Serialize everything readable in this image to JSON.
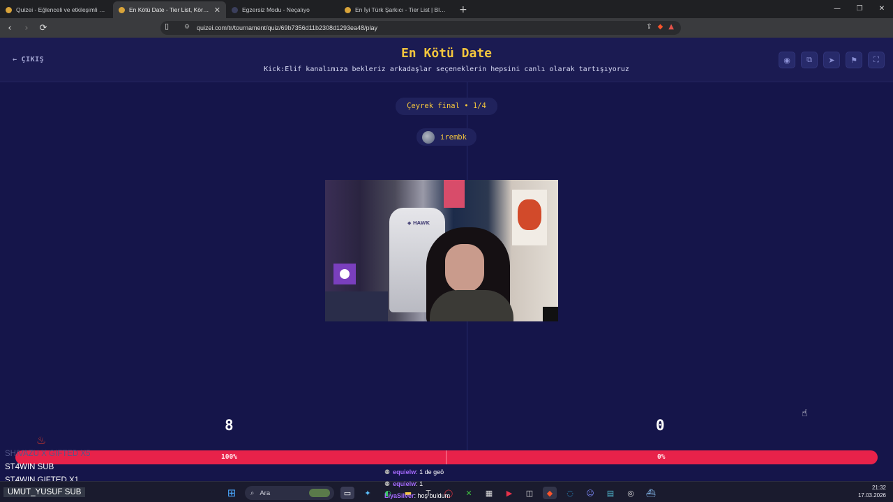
{
  "browser": {
    "tabs": [
      {
        "title": "Quizei - Eğlenceli ve etkileşimli quiz",
        "active": false,
        "icon": "quizei-favicon-icon"
      },
      {
        "title": "En Kötü Date - Tier List, Kör Sıral",
        "active": true,
        "icon": "quizei-favicon-icon"
      },
      {
        "title": "Egzersiz Modu - Neçalıyo",
        "active": false,
        "icon": "page-favicon-icon"
      },
      {
        "title": "En İyi Türk Şarkıcı - Tier List | Blind Ra",
        "active": false,
        "icon": "quizei-favicon-icon"
      }
    ],
    "url": "quizei.com/tr/tournament/quiz/69b7356d11b2308d1293ea48/play"
  },
  "header": {
    "exit_label": "ÇIKIŞ",
    "title": "En Kötü Date",
    "subtitle": "Kick:Elif kanalımıza bekleriz arkadaşlar seçeneklerin hepsini canlı olarak tartışıyoruz",
    "actions": [
      "eye-icon",
      "share-icon",
      "send-icon",
      "flag-icon",
      "fullscreen-icon"
    ]
  },
  "match": {
    "round": "Çeyrek final • 1/4",
    "current_item": "irembk",
    "left_score": "8",
    "right_score": "0",
    "left_percent": "100%",
    "right_percent": "0%",
    "left_share": 1.0
  },
  "overlays": {
    "faded_line": "SHIVAZU X GIFTED X5",
    "lines": [
      "ST4WIN  SUB",
      "ST4WIN  GIFTED X1",
      "UMUT_YUSUF  SUB"
    ],
    "chat": [
      {
        "user": "equielw",
        "text": ": 1 de geö"
      },
      {
        "user": "equielw",
        "text": ": 1"
      },
      {
        "user": "LiyaSilver",
        "text": ": hoş buldum"
      }
    ]
  },
  "taskbar": {
    "search_placeholder": "Ara",
    "time": "21:32",
    "date": "17.03.2026"
  },
  "colors": {
    "page_bg": "#15154a",
    "accent_yellow": "#f4c63d",
    "bar_red": "#e8224a"
  }
}
